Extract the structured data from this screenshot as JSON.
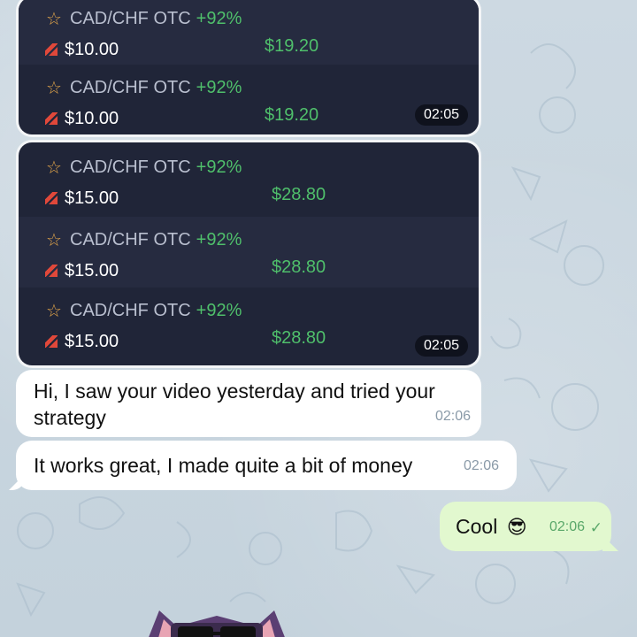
{
  "card_group_1": {
    "trades": [
      {
        "pair": "CAD/CHF OTC",
        "percent": "+92%",
        "amount": "$10.00",
        "payout": "$19.20"
      },
      {
        "pair": "CAD/CHF OTC",
        "percent": "+92%",
        "amount": "$10.00",
        "payout": "$19.20"
      }
    ],
    "time": "02:05"
  },
  "card_group_2": {
    "trades": [
      {
        "pair": "CAD/CHF OTC",
        "percent": "+92%",
        "amount": "$15.00",
        "payout": "$28.80"
      },
      {
        "pair": "CAD/CHF OTC",
        "percent": "+92%",
        "amount": "$15.00",
        "payout": "$28.80"
      },
      {
        "pair": "CAD/CHF OTC",
        "percent": "+92%",
        "amount": "$15.00",
        "payout": "$28.80"
      }
    ],
    "time": "02:05"
  },
  "messages": [
    {
      "text_line1": "Hi, I saw your video yesterday and tried your",
      "text_line2": "strategy",
      "time": "02:06"
    },
    {
      "text": "It works great, I made quite a bit of money",
      "time": "02:06"
    },
    {
      "text": "Cool",
      "emoji": "😎",
      "time": "02:06"
    }
  ],
  "colors": {
    "card_bg": "#202538",
    "profit_green": "#4fbf6b",
    "loss_red": "#e0483a",
    "star": "#e4a64a",
    "outgoing_bubble": "#e2f8cf"
  }
}
